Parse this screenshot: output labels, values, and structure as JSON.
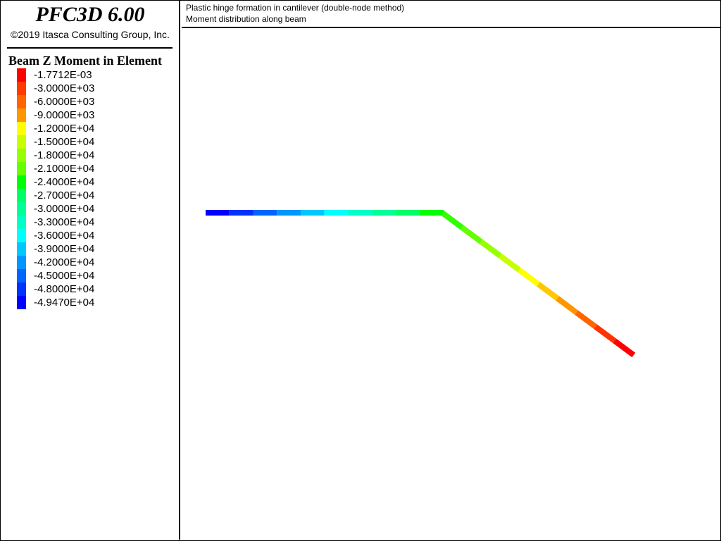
{
  "app": {
    "title": "PFC3D 6.00",
    "copyright": "©2019 Itasca Consulting Group, Inc."
  },
  "plot": {
    "title_line1": "Plastic hinge formation in cantilever (double-node method)",
    "title_line2": "Moment distribution along beam"
  },
  "legend": {
    "title": "Beam Z Moment in Element",
    "entries": [
      {
        "label": "-1.7712E-03",
        "color": "#ff0000"
      },
      {
        "label": "-3.0000E+03",
        "color": "#ff3b00"
      },
      {
        "label": "-6.0000E+03",
        "color": "#ff6400"
      },
      {
        "label": "-9.0000E+03",
        "color": "#ff9600"
      },
      {
        "label": "-1.2000E+04",
        "color": "#ffff00"
      },
      {
        "label": "-1.5000E+04",
        "color": "#c8ff00"
      },
      {
        "label": "-1.8000E+04",
        "color": "#96ff00"
      },
      {
        "label": "-2.1000E+04",
        "color": "#64ff00"
      },
      {
        "label": "-2.4000E+04",
        "color": "#00ff00"
      },
      {
        "label": "-2.7000E+04",
        "color": "#00ff64"
      },
      {
        "label": "-3.0000E+04",
        "color": "#00ff96"
      },
      {
        "label": "-3.3000E+04",
        "color": "#00ffc8"
      },
      {
        "label": "-3.6000E+04",
        "color": "#00ffff"
      },
      {
        "label": "-3.9000E+04",
        "color": "#00c8ff"
      },
      {
        "label": "-4.2000E+04",
        "color": "#0096ff"
      },
      {
        "label": "-4.5000E+04",
        "color": "#0064ff"
      },
      {
        "label": "-4.8000E+04",
        "color": "#0032ff"
      },
      {
        "label": "-4.9470E+04",
        "color": "#0000ff"
      }
    ]
  },
  "beam": {
    "segments": [
      {
        "color": "#0000ff"
      },
      {
        "color": "#0032ff"
      },
      {
        "color": "#0064ff"
      },
      {
        "color": "#0096ff"
      },
      {
        "color": "#00c8ff"
      },
      {
        "color": "#00ffff"
      },
      {
        "color": "#00ffc8"
      },
      {
        "color": "#00ff96"
      },
      {
        "color": "#00ff64"
      },
      {
        "color": "#00ff00"
      },
      {
        "color": "#32ff00"
      },
      {
        "color": "#64ff00"
      },
      {
        "color": "#96ff00"
      },
      {
        "color": "#c8ff00"
      },
      {
        "color": "#ffff00"
      },
      {
        "color": "#ffc800"
      },
      {
        "color": "#ff9600"
      },
      {
        "color": "#ff6400"
      },
      {
        "color": "#ff3200"
      },
      {
        "color": "#ff0000"
      }
    ]
  }
}
